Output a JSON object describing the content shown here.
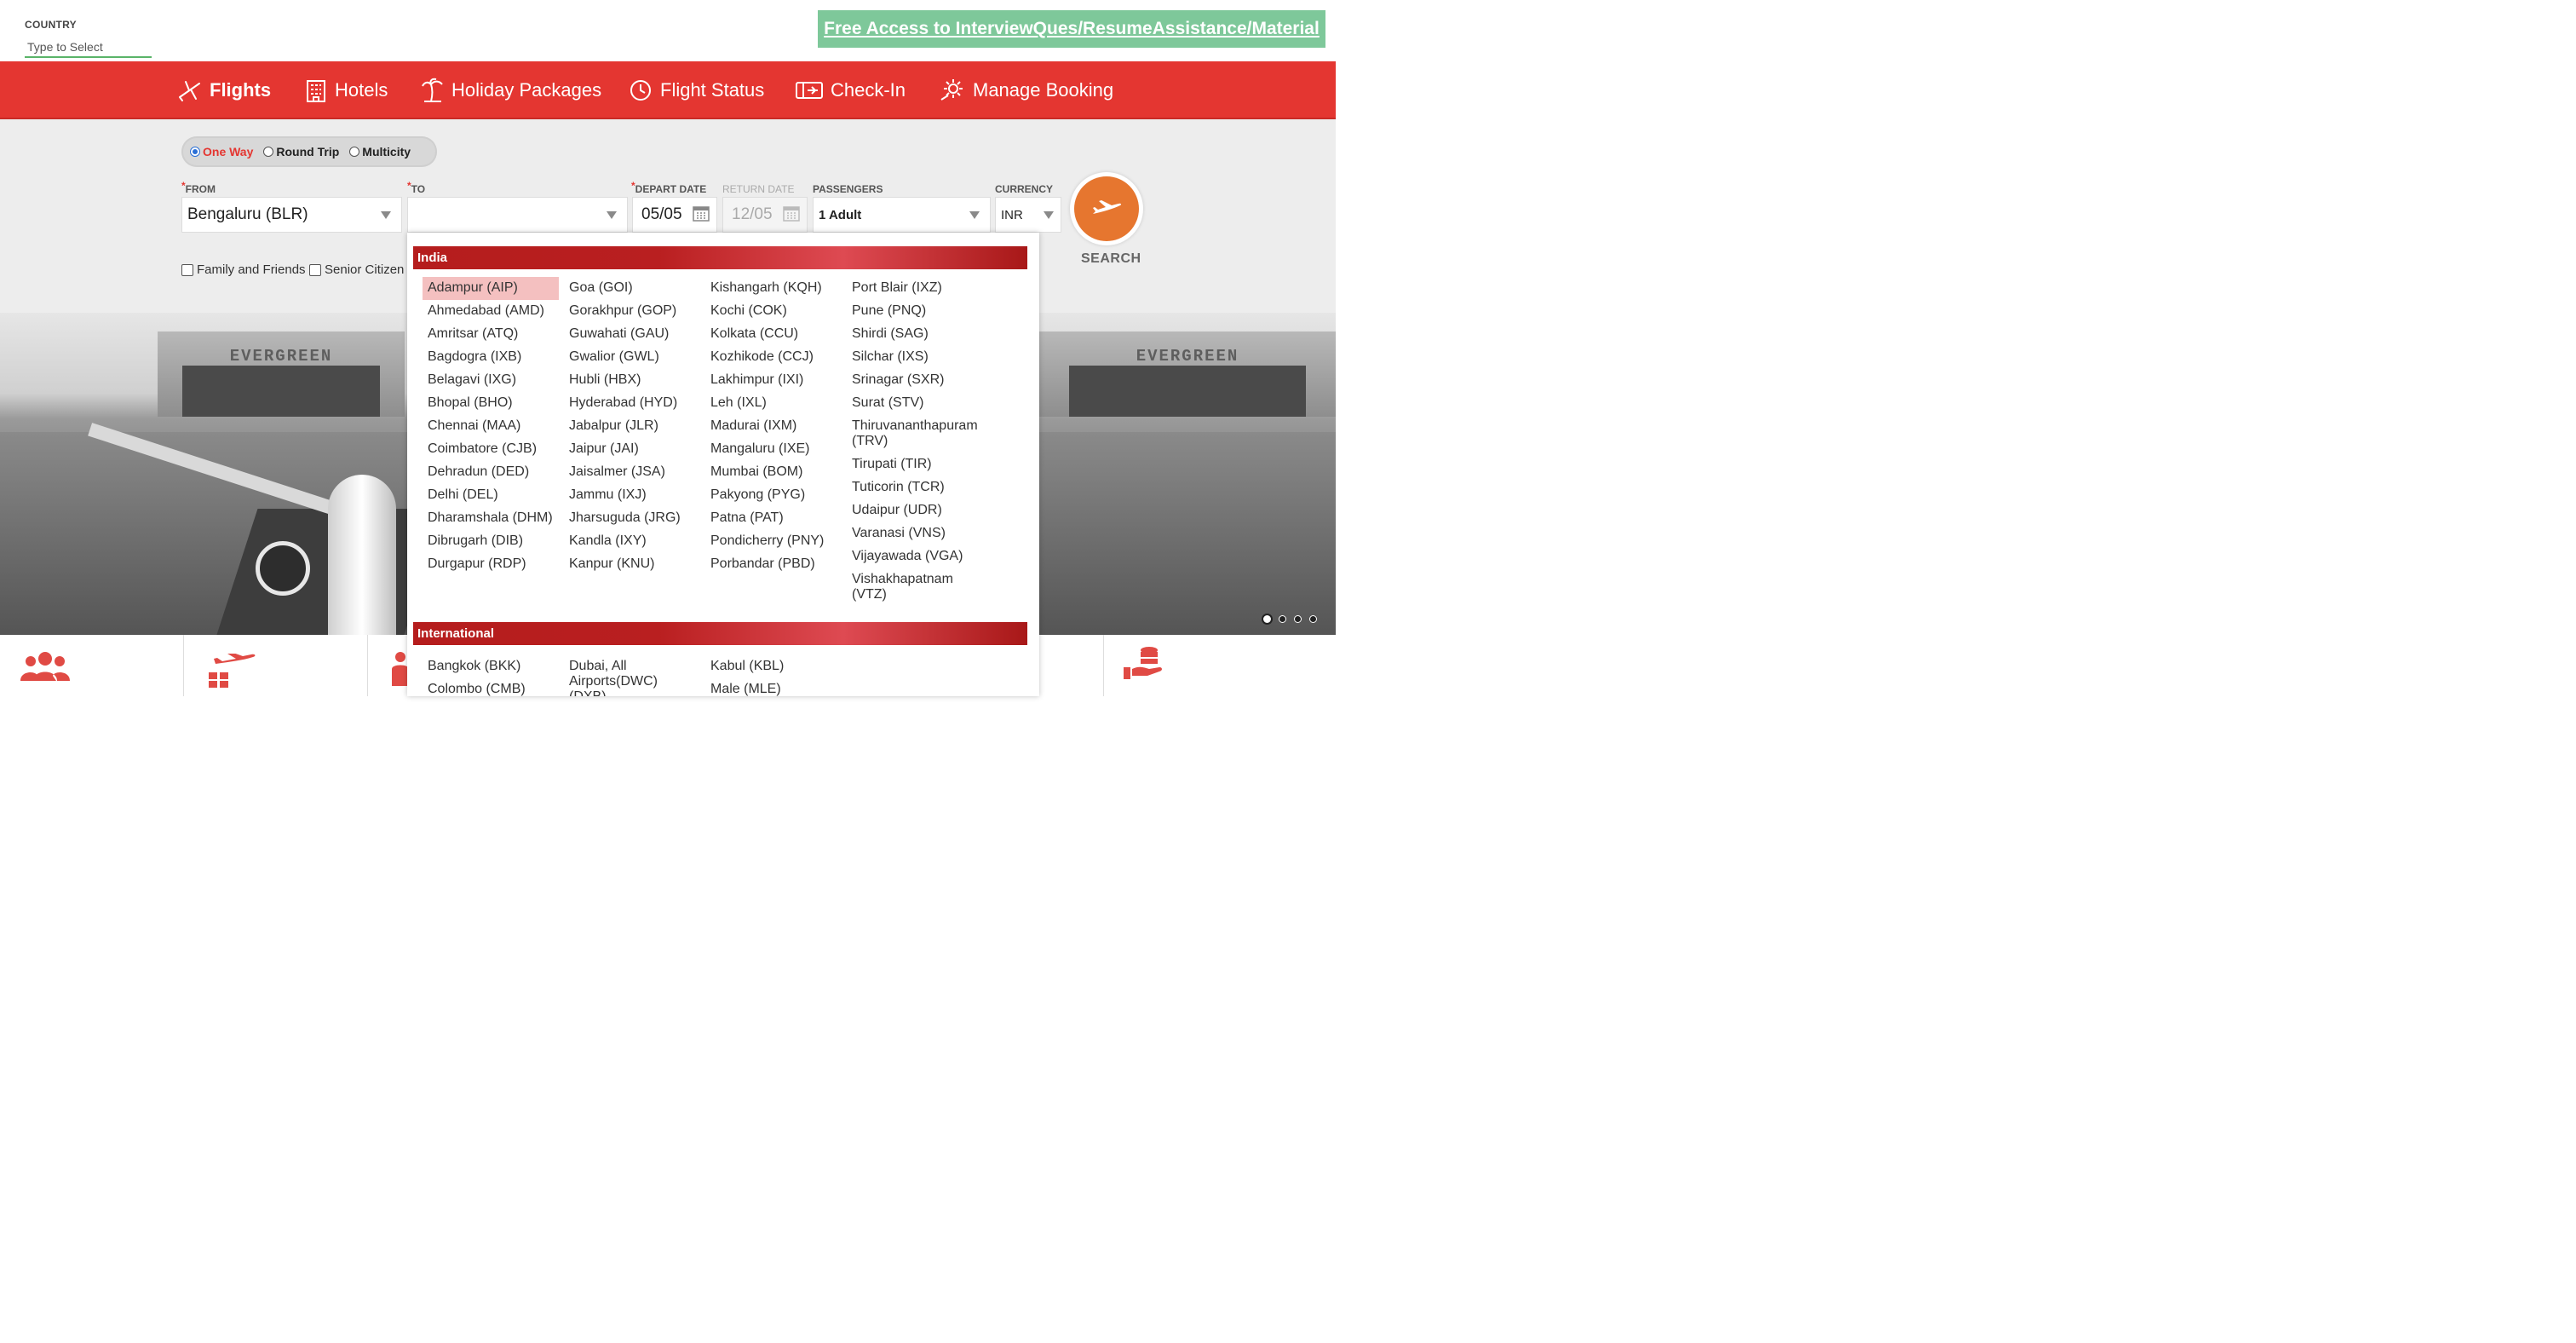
{
  "country": {
    "label": "COUNTRY",
    "placeholder": "Type to Select"
  },
  "promo": "Free Access to InterviewQues/ResumeAssistance/Material",
  "nav": {
    "flights": "Flights",
    "hotels": "Hotels",
    "holiday": "Holiday Packages",
    "status": "Flight Status",
    "checkin": "Check-In",
    "manage": "Manage Booking"
  },
  "trip_type": {
    "one_way": "One Way",
    "round_trip": "Round Trip",
    "multicity": "Multicity",
    "selected": "One Way"
  },
  "form": {
    "from_label": "FROM",
    "from_value": "Bengaluru (BLR)",
    "to_label": "TO",
    "to_value": "",
    "depart_label": "DEPART DATE",
    "depart_value": "05/05",
    "return_label": "RETURN DATE",
    "return_value": "12/05",
    "pax_label": "PASSENGERS",
    "pax_value": "1 Adult",
    "currency_label": "CURRENCY",
    "currency_value": "INR",
    "required_mark": "*",
    "family": "Family and Friends",
    "senior": "Senior Citizen",
    "search": "SEARCH"
  },
  "hero": {
    "hangar_sign": "EVERGREEN"
  },
  "dropdown": {
    "india_heading": "India",
    "india": [
      [
        "Adampur (AIP)",
        "Ahmedabad (AMD)",
        "Amritsar (ATQ)",
        "Bagdogra (IXB)",
        "Belagavi (IXG)",
        "Bhopal (BHO)",
        "Chennai (MAA)",
        "Coimbatore (CJB)",
        "Dehradun (DED)",
        "Delhi (DEL)",
        "Dharamshala (DHM)",
        "Dibrugarh (DIB)",
        "Durgapur (RDP)"
      ],
      [
        "Goa (GOI)",
        "Gorakhpur (GOP)",
        "Guwahati (GAU)",
        "Gwalior (GWL)",
        "Hubli (HBX)",
        "Hyderabad (HYD)",
        "Jabalpur (JLR)",
        "Jaipur (JAI)",
        "Jaisalmer (JSA)",
        "Jammu (IXJ)",
        "Jharsuguda (JRG)",
        "Kandla (IXY)",
        "Kanpur (KNU)"
      ],
      [
        "Kishangarh (KQH)",
        "Kochi (COK)",
        "Kolkata (CCU)",
        "Kozhikode (CCJ)",
        "Lakhimpur (IXI)",
        "Leh (IXL)",
        "Madurai (IXM)",
        "Mangaluru (IXE)",
        "Mumbai (BOM)",
        "Pakyong (PYG)",
        "Patna (PAT)",
        "Pondicherry (PNY)",
        "Porbandar (PBD)"
      ],
      [
        "Port Blair (IXZ)",
        "Pune (PNQ)",
        "Shirdi (SAG)",
        "Silchar (IXS)",
        "Srinagar (SXR)",
        "Surat (STV)",
        "Thiruvananthapuram (TRV)",
        "Tirupati (TIR)",
        "Tuticorin (TCR)",
        "Udaipur (UDR)",
        "Varanasi (VNS)",
        "Vijayawada (VGA)",
        "Vishakhapatnam (VTZ)"
      ]
    ],
    "highlighted": "Adampur (AIP)",
    "intl_heading": "International",
    "international": [
      [
        "Bangkok (BKK)",
        "Colombo (CMB)"
      ],
      [
        "Dubai, All Airports(DWC) (DXB)"
      ],
      [
        "Kabul (KBL)",
        "Male (MLE)"
      ]
    ]
  },
  "icons": {
    "nav": [
      "plane-icon",
      "hotel-icon",
      "palm-tree-icon",
      "clock-plane-icon",
      "ticket-icon",
      "gear-icon"
    ],
    "strip": [
      "group-icon",
      "cargo-plane-icon",
      "person-icon",
      "hand-coins-icon"
    ]
  },
  "colors": {
    "nav_bg": "#e43631",
    "promo_bg": "#7ec89a",
    "search_btn": "#e6762f",
    "highlight": "#f4c0c0"
  }
}
